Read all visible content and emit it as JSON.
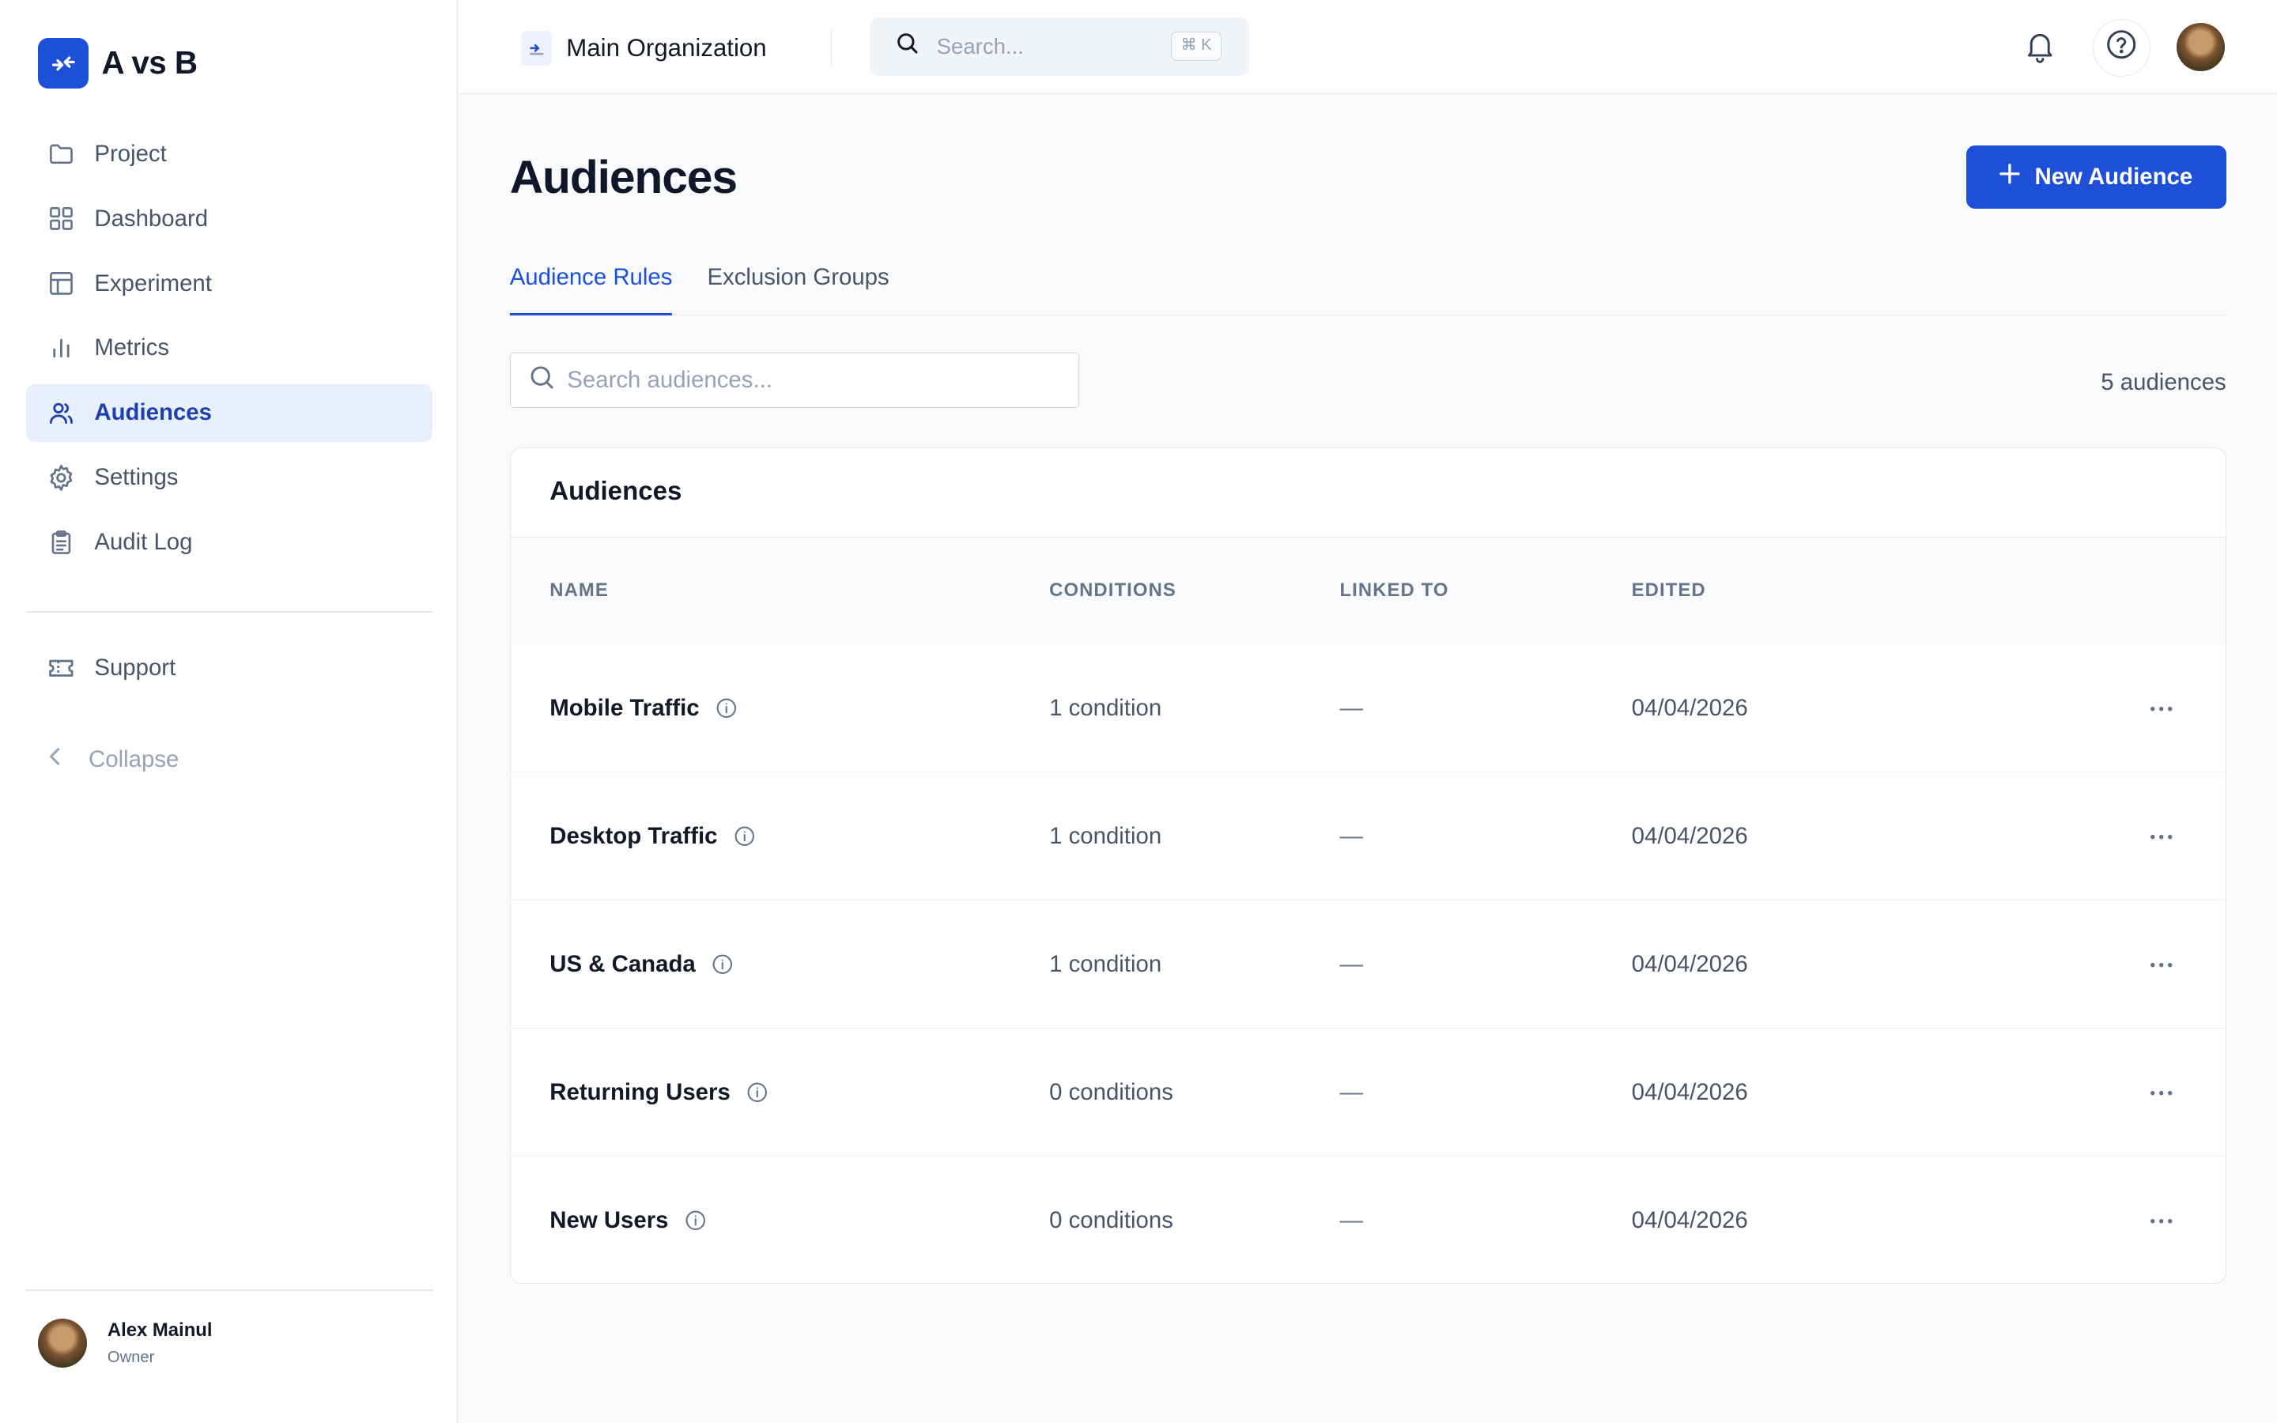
{
  "brand": {
    "name": "A vs B"
  },
  "sidebar": {
    "items": [
      {
        "label": "Project",
        "icon": "folder-icon",
        "active": false
      },
      {
        "label": "Dashboard",
        "icon": "grid-icon",
        "active": false
      },
      {
        "label": "Experiment",
        "icon": "table-icon",
        "active": false
      },
      {
        "label": "Metrics",
        "icon": "bar-chart-icon",
        "active": false
      },
      {
        "label": "Audiences",
        "icon": "users-icon",
        "active": true
      },
      {
        "label": "Settings",
        "icon": "gear-icon",
        "active": false
      },
      {
        "label": "Audit Log",
        "icon": "clipboard-icon",
        "active": false
      }
    ],
    "support_label": "Support",
    "collapse_label": "Collapse",
    "user": {
      "name": "Alex Mainul",
      "role": "Owner"
    }
  },
  "topbar": {
    "org_name": "Main Organization",
    "search_placeholder": "Search...",
    "shortcut": "⌘ K"
  },
  "main": {
    "title": "Audiences",
    "new_button_label": "New Audience",
    "tabs": [
      {
        "label": "Audience Rules",
        "active": true
      },
      {
        "label": "Exclusion Groups",
        "active": false
      }
    ],
    "search_placeholder": "Search audiences...",
    "count_label": "5 audiences",
    "card_title": "Audiences",
    "columns": {
      "name": "NAME",
      "conditions": "CONDITIONS",
      "linked_to": "LINKED TO",
      "edited": "EDITED"
    },
    "rows": [
      {
        "name": "Mobile Traffic",
        "conditions": "1 condition",
        "linked_to": "—",
        "edited": "04/04/2026"
      },
      {
        "name": "Desktop Traffic",
        "conditions": "1 condition",
        "linked_to": "—",
        "edited": "04/04/2026"
      },
      {
        "name": "US & Canada",
        "conditions": "1 condition",
        "linked_to": "—",
        "edited": "04/04/2026"
      },
      {
        "name": "Returning Users",
        "conditions": "0 conditions",
        "linked_to": "—",
        "edited": "04/04/2026"
      },
      {
        "name": "New Users",
        "conditions": "0 conditions",
        "linked_to": "—",
        "edited": "04/04/2026"
      }
    ]
  },
  "colors": {
    "accent": "#1d4fd8",
    "active_bg": "#e8f0fe",
    "text": "#0f172a"
  }
}
